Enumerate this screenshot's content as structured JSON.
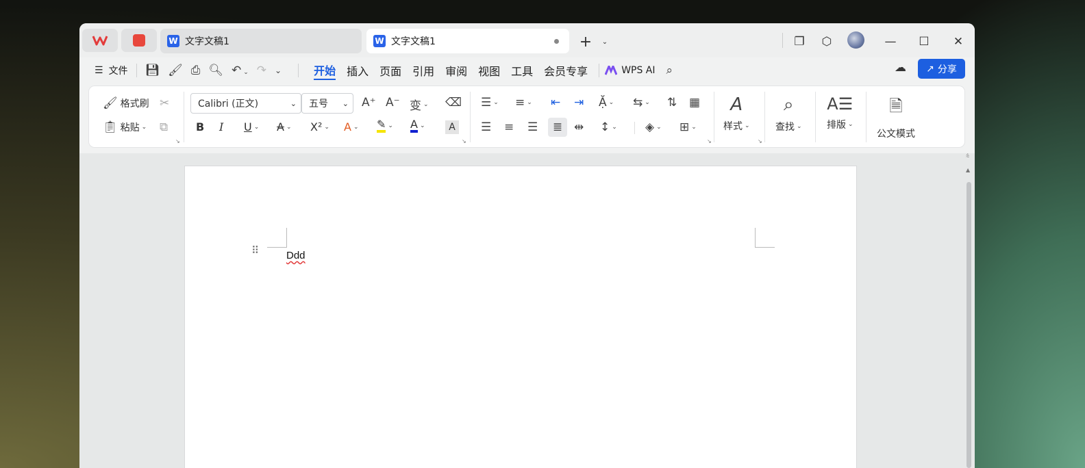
{
  "tabs": [
    {
      "label": "文字文稿1",
      "active": false
    },
    {
      "label": "文字文稿1",
      "active": true
    }
  ],
  "menu": {
    "file_label": "文件",
    "items": [
      "开始",
      "插入",
      "页面",
      "引用",
      "审阅",
      "视图",
      "工具",
      "会员专享"
    ],
    "active": "开始",
    "ai_label": "WPS AI",
    "share_label": "分享"
  },
  "ribbon": {
    "format_painter": "格式刷",
    "paste": "粘贴",
    "font_name": "Calibri (正文)",
    "font_size": "五号",
    "styles": "样式",
    "find": "查找",
    "layout": "排版",
    "official_mode": "公文模式"
  },
  "document": {
    "text": "Ddd"
  },
  "colors": {
    "accent": "#1d5fe0",
    "highlight": "#f5e400",
    "font_color": "#1020d0"
  }
}
